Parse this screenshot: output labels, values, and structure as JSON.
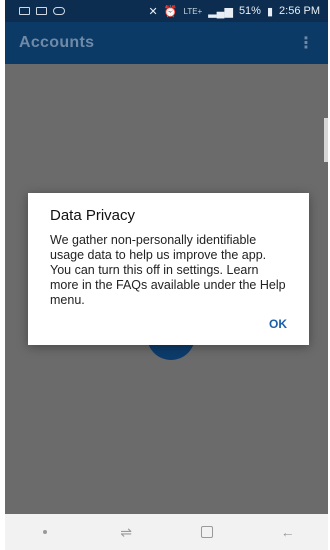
{
  "status_bar": {
    "signal": "LTE+",
    "battery": "51%",
    "time": "2:56 PM"
  },
  "app_bar": {
    "title": "Accounts",
    "overflow_icon": "⋮"
  },
  "dialog": {
    "title": "Data Privacy",
    "message": "We gather non-personally identifiable usage data to help us improve the app. You can turn this off in settings. Learn more in the FAQs available under the Help menu.",
    "ok_label": "OK"
  },
  "nav_bar": {
    "back_icon": "←",
    "home_icon": "▢",
    "recents_icon": "⇌"
  },
  "colors": {
    "app_bar": "#0b3a66",
    "accent": "#1a5fa8"
  }
}
